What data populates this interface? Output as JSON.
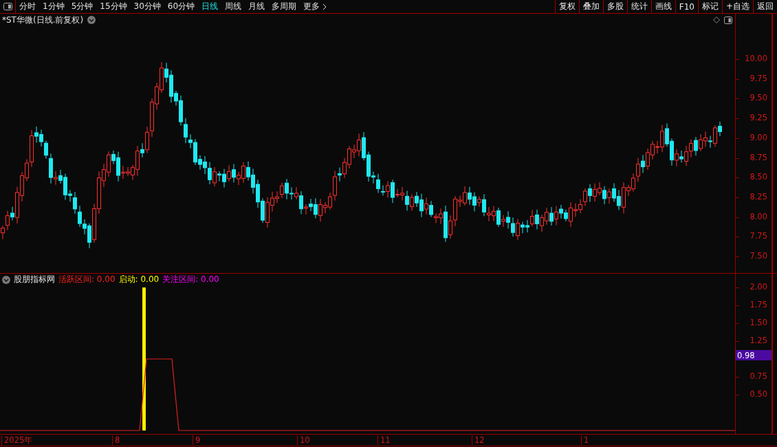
{
  "toolbar": {
    "periods": [
      {
        "label": "分时",
        "selected": false
      },
      {
        "label": "1分钟",
        "selected": false
      },
      {
        "label": "5分钟",
        "selected": false
      },
      {
        "label": "15分钟",
        "selected": false
      },
      {
        "label": "30分钟",
        "selected": false
      },
      {
        "label": "60分钟",
        "selected": false
      },
      {
        "label": "日线",
        "selected": true
      },
      {
        "label": "周线",
        "selected": false
      },
      {
        "label": "月线",
        "selected": false
      },
      {
        "label": "多周期",
        "selected": false
      },
      {
        "label": "更多",
        "selected": false
      }
    ],
    "actions": [
      "复权",
      "叠加",
      "多股",
      "统计",
      "画线",
      "F10",
      "标记",
      "+自选",
      "返回"
    ]
  },
  "chart": {
    "title": "*ST华微(日线.前复权)",
    "price_axis": [
      "10.00",
      "9.75",
      "9.50",
      "9.25",
      "9.00",
      "8.75",
      "8.50",
      "8.25",
      "8.00",
      "7.75",
      "7.50"
    ]
  },
  "indicator": {
    "name": "股朋指标网",
    "values": [
      {
        "label": "活跃区间: 0.00",
        "color": "#ff2020"
      },
      {
        "label": "启动: 0.00",
        "color": "#ffff00"
      },
      {
        "label": "关注区间: 0.00",
        "color": "#ff00ff"
      }
    ],
    "axis": [
      "2.00",
      "1.75",
      "1.50",
      "1.25",
      "0.75",
      "0.50"
    ],
    "current": "0.98"
  },
  "date_axis": [
    "2025年",
    "8",
    "9",
    "10",
    "11",
    "12",
    "1"
  ]
}
